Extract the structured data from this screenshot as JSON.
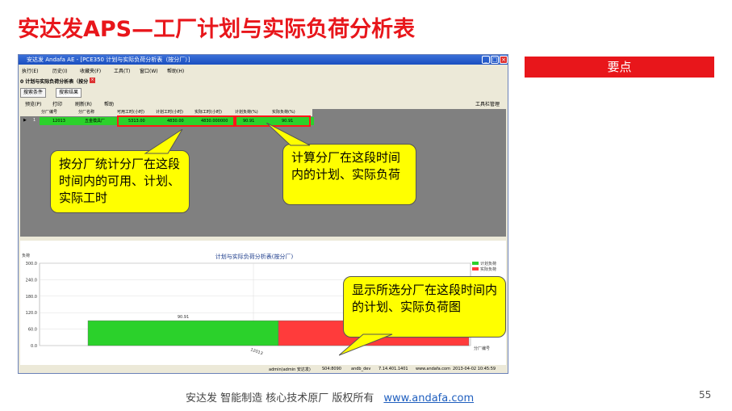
{
  "slide": {
    "title": "安达发APS—工厂计划与实际负荷分析表",
    "keypoint_label": "要点",
    "footer_text": "安达发  智能制造 核心技术原厂  版权所有",
    "footer_link": "www.andafa.com",
    "page_number": "55"
  },
  "window": {
    "title": "安达发 Andafa AE - [PCE350 计划与实际负荷分析表（按分厂）]",
    "menu": [
      "执行(E)",
      "历史(I)",
      "收藏夹(F)",
      "工具(T)",
      "窗口(W)",
      "帮助(H)"
    ],
    "doc_tab": "0 计划与实际负荷分析表（按分",
    "tabs": [
      "搜索条件",
      "搜索结果"
    ],
    "toolbar": [
      "预览(P)",
      "打印",
      "刷新(R)",
      "帮助"
    ],
    "toolbar_right": "工具栏管理",
    "grid": {
      "headers": [
        "分厂编号",
        "分厂名称",
        "可用工时(小时)",
        "计划工时(小时)",
        "实际工时(小时)",
        "计划负荷(%)",
        "实际负荷(%)"
      ],
      "row": {
        "index": "1",
        "code": "12013",
        "name": "五金模具厂",
        "available": "5313.00",
        "planned": "4830.00",
        "actual": "4830.000000",
        "plan_load": "90.91",
        "actual_load": "90.91"
      }
    },
    "status": {
      "user": "admin(admin 安达发)",
      "server": "S04:8090",
      "db": "andb_dev",
      "ip": "7.14.401.1401",
      "site": "www.andafa.com",
      "time": "2013-04-02 10:45:59"
    }
  },
  "callouts": {
    "hours": "按分厂统计分厂在这段时间内的可用、计划、实际工时",
    "load": "计算分厂在这段时间内的计划、实际负荷",
    "chart": "显示所选分厂在这段时间内的计划、实际负荷图"
  },
  "colors": {
    "accent": "#e8161b",
    "plan": "#2bd12b",
    "actual": "#ff3b3b",
    "callout": "#ffff00"
  },
  "chart_data": {
    "type": "bar",
    "title": "计划与实际负荷分析表(按分厂)",
    "ylabel": "负荷",
    "xlabel": "分厂编号",
    "categories": [
      "12013"
    ],
    "series": [
      {
        "name": "计划负荷",
        "values": [
          90.91
        ]
      },
      {
        "name": "实际负荷",
        "values": [
          90.91
        ]
      }
    ],
    "ylim": [
      0,
      300
    ],
    "yticks": [
      "0.0",
      "60.0",
      "120.0",
      "180.0",
      "240.0",
      "300.0"
    ],
    "data_labels": [
      "90.91"
    ],
    "legend": "top-right"
  }
}
